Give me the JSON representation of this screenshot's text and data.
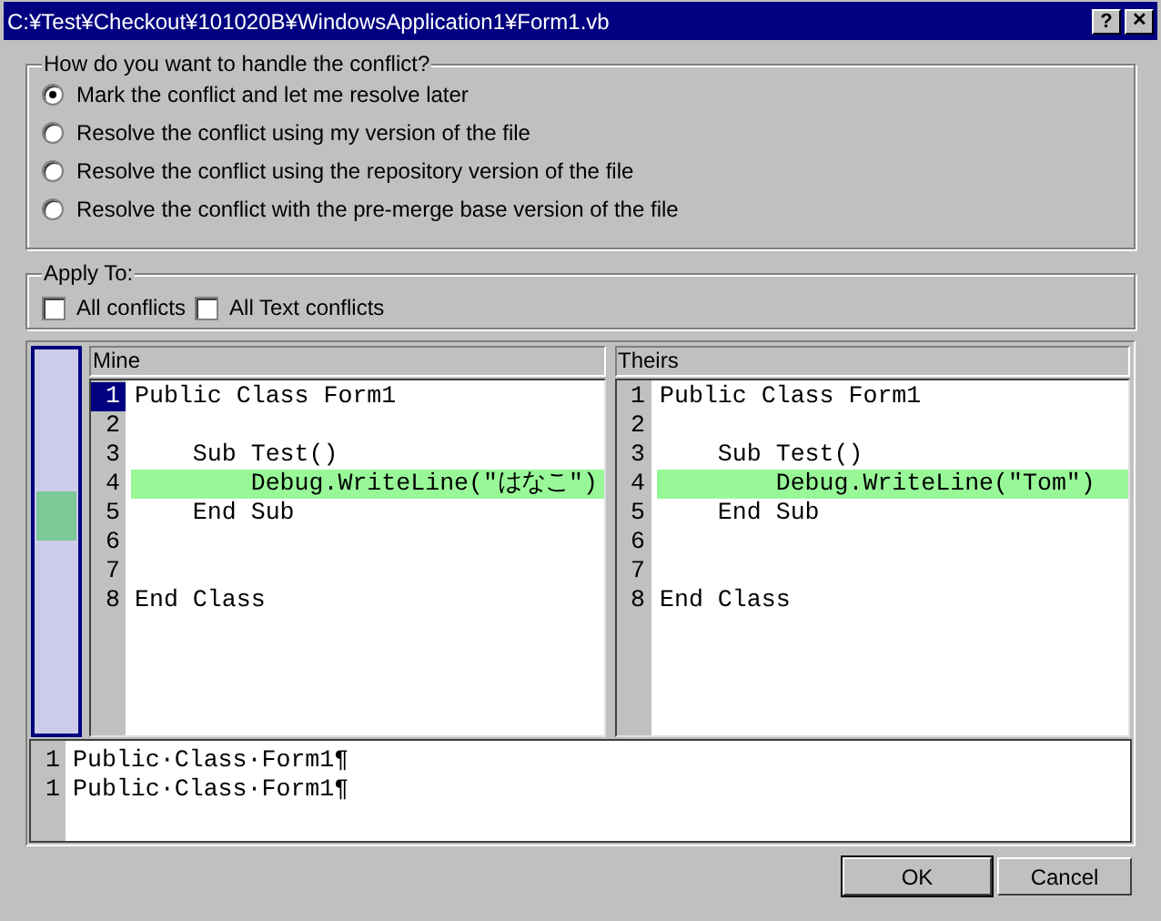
{
  "window": {
    "title": "C:¥Test¥Checkout¥101020B¥WindowsApplication1¥Form1.vb",
    "help_button": "?",
    "close_button": "✕"
  },
  "handling": {
    "legend": "How do you want to handle the conflict?",
    "options": [
      {
        "label": "Mark the conflict and let me resolve later",
        "selected": true
      },
      {
        "label": "Resolve the conflict using my version of the file",
        "selected": false
      },
      {
        "label": "Resolve the conflict using the repository version of the file",
        "selected": false
      },
      {
        "label": "Resolve the conflict with the pre-merge base version of the file",
        "selected": false
      }
    ]
  },
  "apply_to": {
    "legend": "Apply To:",
    "options": [
      {
        "label": "All conflicts",
        "checked": false
      },
      {
        "label": "All Text conflicts",
        "checked": false
      }
    ]
  },
  "panes": [
    {
      "title": "Mine",
      "lines": [
        {
          "number": "1",
          "text": "Public Class Form1",
          "changed": false,
          "selected": true
        },
        {
          "number": "2",
          "changed": false,
          "selected": false
        },
        {
          "number": "3",
          "text": "    Sub Test()",
          "changed": false,
          "selected": false
        },
        {
          "number": "4",
          "text": "        Debug.WriteLine(\"はなこ\")",
          "changed": true,
          "selected": false
        },
        {
          "number": "5",
          "text": "    End Sub",
          "changed": false,
          "selected": false
        },
        {
          "number": "6",
          "changed": false,
          "selected": false
        },
        {
          "number": "7",
          "changed": false,
          "selected": false
        },
        {
          "number": "8",
          "text": "End Class",
          "changed": false,
          "selected": false
        }
      ]
    },
    {
      "title": "Theirs",
      "lines": [
        {
          "number": "1",
          "text": "Public Class Form1",
          "changed": false,
          "selected": false
        },
        {
          "number": "2",
          "changed": false,
          "selected": false
        },
        {
          "number": "3",
          "text": "    Sub Test()",
          "changed": false,
          "selected": false
        },
        {
          "number": "4",
          "text": "        Debug.WriteLine(\"Tom\")",
          "changed": true,
          "selected": false
        },
        {
          "number": "5",
          "text": "    End Sub",
          "changed": false,
          "selected": false
        },
        {
          "number": "6",
          "changed": false,
          "selected": false
        },
        {
          "number": "7",
          "changed": false,
          "selected": false
        },
        {
          "number": "8",
          "text": "End Class",
          "changed": false,
          "selected": false
        }
      ]
    }
  ],
  "compare": [
    {
      "number": "1",
      "text": "Public·Class·Form1¶"
    },
    {
      "number": "1",
      "text": "Public·Class·Form1¶"
    }
  ],
  "buttons": [
    "OK",
    "Cancel"
  ]
}
